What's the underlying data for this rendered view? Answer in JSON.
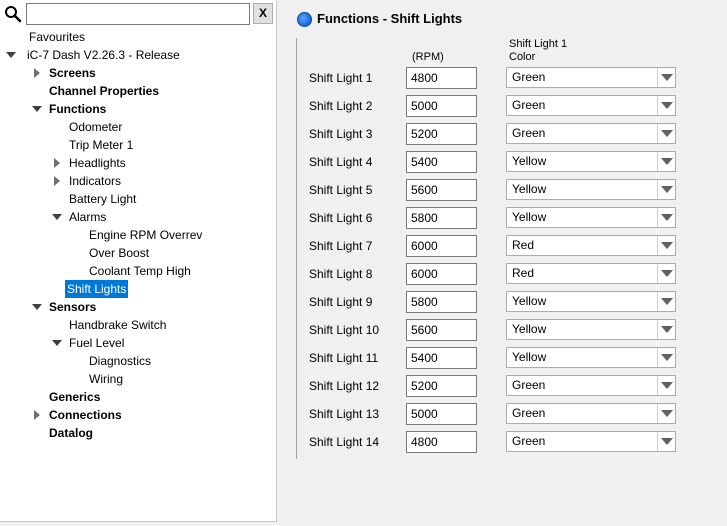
{
  "search": {
    "value": "",
    "placeholder": "",
    "clear_label": "X"
  },
  "tree": [
    {
      "label": "Favourites",
      "level": 0,
      "arrow": "none",
      "bold": false,
      "selected": false,
      "x": 27
    },
    {
      "label": "iC-7 Dash V2.26.3 - Release",
      "level": 0,
      "arrow": "down",
      "bold": false,
      "selected": false,
      "x": 25
    },
    {
      "label": "Screens",
      "level": 1,
      "arrow": "right",
      "bold": true,
      "selected": false,
      "x": 47
    },
    {
      "label": "Channel Properties",
      "level": 1,
      "arrow": "none",
      "bold": true,
      "selected": false,
      "x": 47
    },
    {
      "label": "Functions",
      "level": 1,
      "arrow": "down",
      "bold": true,
      "selected": false,
      "x": 47
    },
    {
      "label": "Odometer",
      "level": 2,
      "arrow": "none",
      "bold": false,
      "selected": false,
      "x": 67
    },
    {
      "label": "Trip Meter 1",
      "level": 2,
      "arrow": "none",
      "bold": false,
      "selected": false,
      "x": 67
    },
    {
      "label": "Headlights",
      "level": 2,
      "arrow": "right",
      "bold": false,
      "selected": false,
      "x": 67
    },
    {
      "label": "Indicators",
      "level": 2,
      "arrow": "right",
      "bold": false,
      "selected": false,
      "x": 67
    },
    {
      "label": "Battery Light",
      "level": 2,
      "arrow": "none",
      "bold": false,
      "selected": false,
      "x": 67
    },
    {
      "label": "Alarms",
      "level": 2,
      "arrow": "down",
      "bold": false,
      "selected": false,
      "x": 67
    },
    {
      "label": "Engine RPM Overrev",
      "level": 3,
      "arrow": "none",
      "bold": false,
      "selected": false,
      "x": 87
    },
    {
      "label": "Over Boost",
      "level": 3,
      "arrow": "none",
      "bold": false,
      "selected": false,
      "x": 87
    },
    {
      "label": "Coolant Temp High",
      "level": 3,
      "arrow": "none",
      "bold": false,
      "selected": false,
      "x": 87
    },
    {
      "label": "Shift Lights",
      "level": 2,
      "arrow": "none",
      "bold": false,
      "selected": true,
      "x": 65
    },
    {
      "label": "Sensors",
      "level": 1,
      "arrow": "down",
      "bold": true,
      "selected": false,
      "x": 47
    },
    {
      "label": "Handbrake Switch",
      "level": 2,
      "arrow": "none",
      "bold": false,
      "selected": false,
      "x": 67
    },
    {
      "label": "Fuel Level",
      "level": 2,
      "arrow": "down",
      "bold": false,
      "selected": false,
      "x": 67
    },
    {
      "label": "Diagnostics",
      "level": 3,
      "arrow": "none",
      "bold": false,
      "selected": false,
      "x": 87
    },
    {
      "label": "Wiring",
      "level": 3,
      "arrow": "none",
      "bold": false,
      "selected": false,
      "x": 87
    },
    {
      "label": "Generics",
      "level": 1,
      "arrow": "none",
      "bold": true,
      "selected": false,
      "x": 47
    },
    {
      "label": "Connections",
      "level": 1,
      "arrow": "right",
      "bold": true,
      "selected": false,
      "x": 47
    },
    {
      "label": "Datalog",
      "level": 1,
      "arrow": "none",
      "bold": true,
      "selected": false,
      "x": 47
    }
  ],
  "panel": {
    "title": "Functions - Shift Lights",
    "rpm_header": "(RPM)",
    "color_header_line1": "Shift Light 1",
    "color_header_line2": "Color"
  },
  "shift_lights": [
    {
      "label": "Shift Light 1",
      "rpm": "4800",
      "color": "Green"
    },
    {
      "label": "Shift Light 2",
      "rpm": "5000",
      "color": "Green"
    },
    {
      "label": "Shift Light 3",
      "rpm": "5200",
      "color": "Green"
    },
    {
      "label": "Shift Light 4",
      "rpm": "5400",
      "color": "Yellow"
    },
    {
      "label": "Shift Light 5",
      "rpm": "5600",
      "color": "Yellow"
    },
    {
      "label": "Shift Light 6",
      "rpm": "5800",
      "color": "Yellow"
    },
    {
      "label": "Shift Light 7",
      "rpm": "6000",
      "color": "Red"
    },
    {
      "label": "Shift Light 8",
      "rpm": "6000",
      "color": "Red"
    },
    {
      "label": "Shift Light 9",
      "rpm": "5800",
      "color": "Yellow"
    },
    {
      "label": "Shift Light 10",
      "rpm": "5600",
      "color": "Yellow"
    },
    {
      "label": "Shift Light 11",
      "rpm": "5400",
      "color": "Yellow"
    },
    {
      "label": "Shift Light 12",
      "rpm": "5200",
      "color": "Green"
    },
    {
      "label": "Shift Light 13",
      "rpm": "5000",
      "color": "Green"
    },
    {
      "label": "Shift Light 14",
      "rpm": "4800",
      "color": "Green"
    }
  ],
  "colors": {
    "selection": "#0078d7",
    "header_icon": "#1565d8"
  }
}
